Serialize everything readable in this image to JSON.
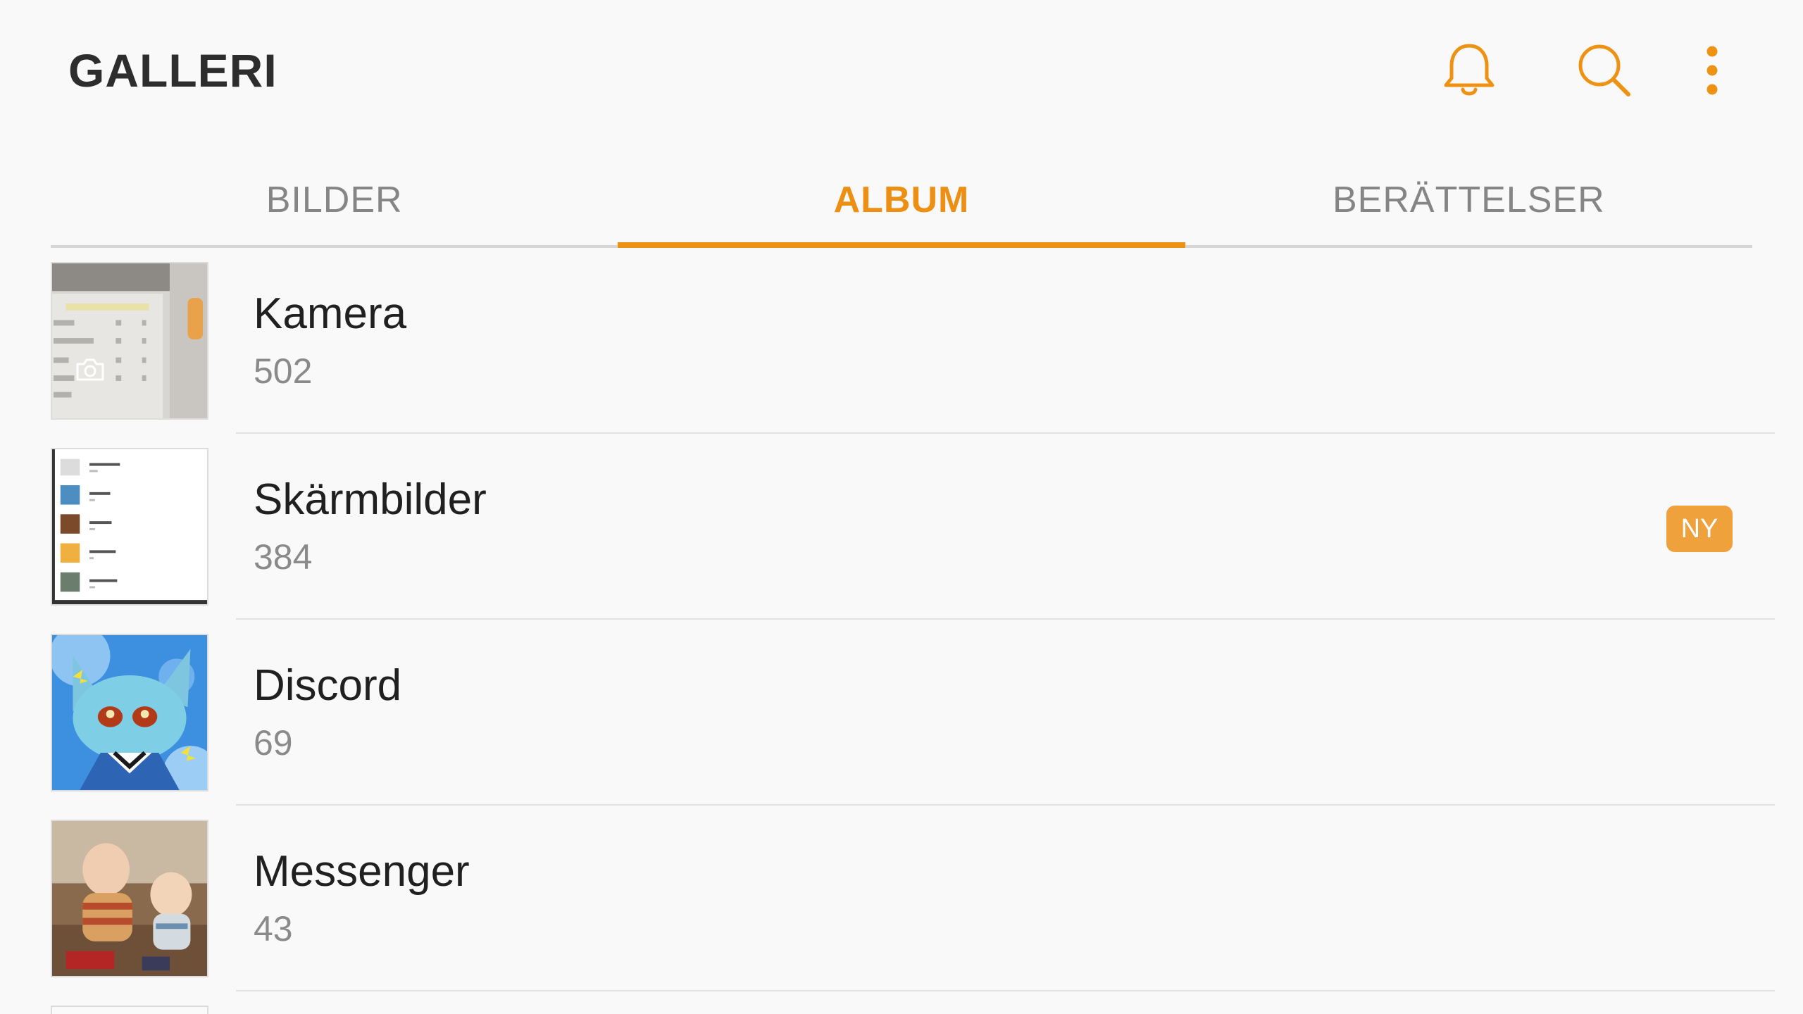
{
  "header": {
    "title": "GALLERI",
    "actions": [
      {
        "icon": "bell-icon"
      },
      {
        "icon": "search-icon"
      },
      {
        "icon": "more-vert-icon"
      }
    ]
  },
  "tabs": [
    {
      "label": "BILDER",
      "active": false
    },
    {
      "label": "ALBUM",
      "active": true
    },
    {
      "label": "BERÄTTELSER",
      "active": false
    }
  ],
  "albums": [
    {
      "name": "Kamera",
      "count": "502",
      "thumbnail_icon": "camera-icon"
    },
    {
      "name": "Skärmbilder",
      "count": "384",
      "badge": "NY"
    },
    {
      "name": "Discord",
      "count": "69"
    },
    {
      "name": "Messenger",
      "count": "43"
    }
  ],
  "colors": {
    "accent": "#ee9213",
    "badge": "#efa13c",
    "background": "#f9f9f9"
  }
}
